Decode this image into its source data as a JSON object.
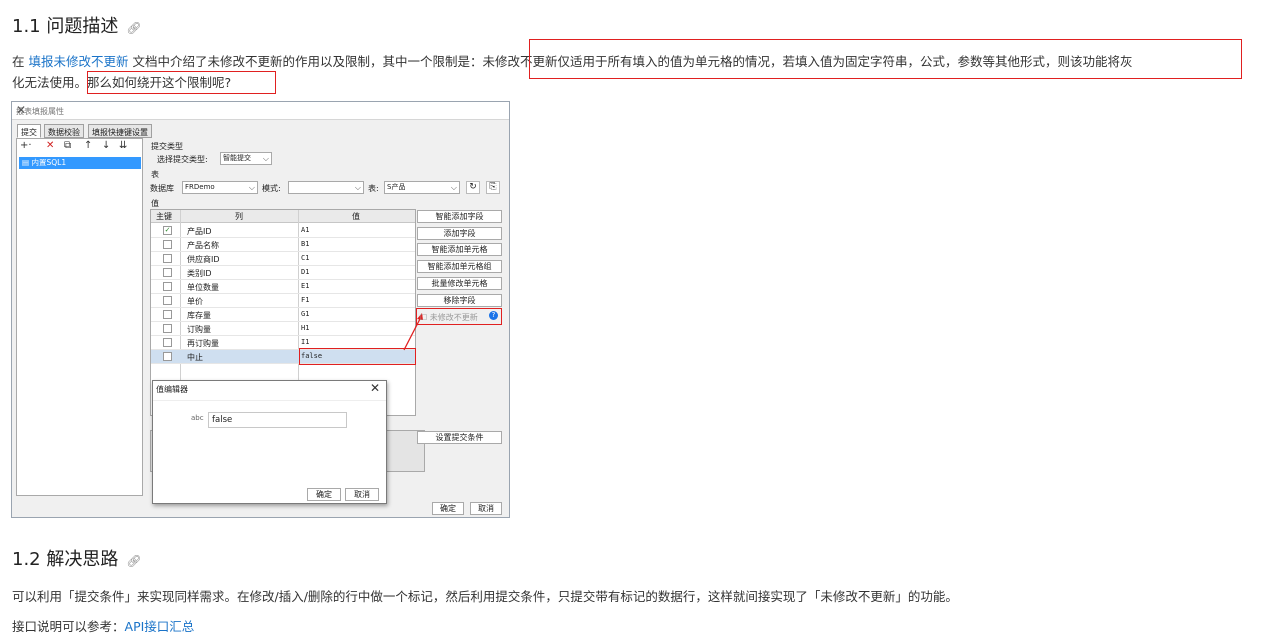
{
  "section1": {
    "heading": "1.1 问题描述",
    "anchor_icon": "link-icon",
    "para_prefix": "在 ",
    "para_link": "填报未修改不更新",
    "para_middle": " 文档中介绍了未修改不更新的作用以及限制，其中一个限制是：",
    "para_highlight": "未修改不更新仅适用于所有填入的值为单元格的情况，若填入值为固定字符串，公式，参数等其他形式，则该功能将灰",
    "para_line2_start": "化无法使用。",
    "para_question": "那么如何绕开这个限制呢?"
  },
  "screenshot": {
    "window_title": "报表填报属性",
    "tabs": [
      "提交",
      "数据校验",
      "填报快捷键设置"
    ],
    "toolbar_icons": [
      "+·",
      "✕",
      "⧉",
      "↑",
      "↓",
      "⇊"
    ],
    "tree_item": "内置SQL1",
    "submit_type_section": "提交类型",
    "submit_type_label": "选择提交类型:",
    "submit_type_value": "智能提交",
    "table_section": "表",
    "database_label": "数据库",
    "database_value": "FRDemo",
    "schema_label": "模式:",
    "schema_value": "",
    "table_label": "表:",
    "table_value": "S产品",
    "value_section": "值",
    "grid_headers": [
      "主键",
      "列",
      "值"
    ],
    "rows": [
      {
        "key": "✓",
        "col": "产品ID",
        "val": "A1"
      },
      {
        "key": "",
        "col": "产品名称",
        "val": "B1"
      },
      {
        "key": "",
        "col": "供应商ID",
        "val": "C1"
      },
      {
        "key": "",
        "col": "类别ID",
        "val": "D1"
      },
      {
        "key": "",
        "col": "单位数量",
        "val": "E1"
      },
      {
        "key": "",
        "col": "单价",
        "val": "F1"
      },
      {
        "key": "",
        "col": "库存量",
        "val": "G1"
      },
      {
        "key": "",
        "col": "订购量",
        "val": "H1"
      },
      {
        "key": "",
        "col": "再订购量",
        "val": "I1"
      },
      {
        "key": "",
        "col": "中止",
        "val": "false"
      }
    ],
    "right_buttons": [
      "智能添加字段",
      "添加字段",
      "智能添加单元格",
      "智能添加单元格组",
      "批量修改单元格",
      "移除字段"
    ],
    "no_update_label": "未修改不更新",
    "help_icon": "question-circle-icon",
    "set_condition_button": "设置提交条件",
    "ok_button": "确定",
    "cancel_button": "取消",
    "popup": {
      "title": "值编辑器",
      "icon_label": "abc",
      "input_value": "false",
      "ok": "确定",
      "cancel": "取消"
    }
  },
  "section2": {
    "heading": "1.2 解决思路",
    "anchor_icon": "link-icon",
    "para": "可以利用「提交条件」来实现同样需求。在修改/插入/删除的行中做一个标记，然后利用提交条件，只提交带有标记的数据行，这样就间接实现了「未修改不更新」的功能。",
    "ref_prefix": "接口说明可以参考：",
    "ref_link": "API接口汇总"
  },
  "colors": {
    "link": "#1a73c8",
    "highlight_border": "#e02020",
    "selection": "#3399ff"
  }
}
